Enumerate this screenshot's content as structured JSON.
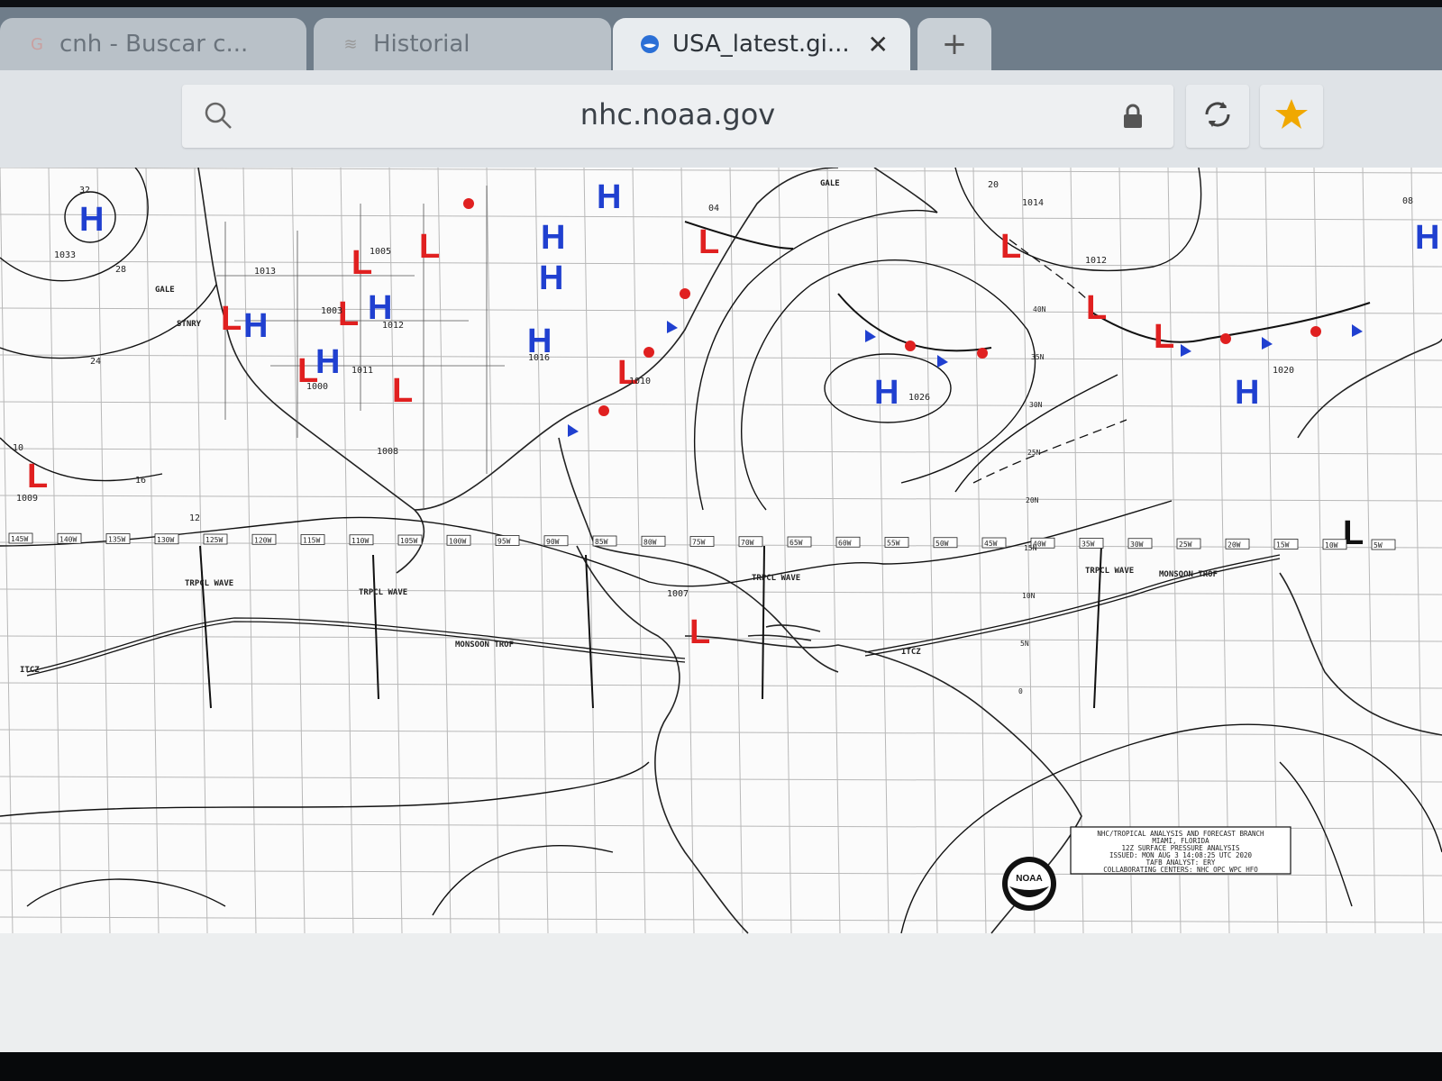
{
  "tabs": [
    {
      "label": "cnh - Buscar c...",
      "icon": "google-icon",
      "active": false
    },
    {
      "label": "Historial",
      "icon": "history-icon",
      "active": false
    },
    {
      "label": "USA_latest.gi...",
      "icon": "noaa-icon",
      "active": true
    }
  ],
  "toolbar": {
    "url": "nhc.noaa.gov"
  },
  "map": {
    "pressure_centers": [
      {
        "type": "H",
        "value": "1033"
      },
      {
        "type": "H",
        "value": "1026"
      },
      {
        "type": "H",
        "value": "1020"
      },
      {
        "type": "L",
        "value": "1009"
      },
      {
        "type": "L",
        "value": "1007"
      },
      {
        "type": "L",
        "value": "1000"
      },
      {
        "type": "L",
        "value": "1005"
      },
      {
        "type": "L",
        "value": "1014"
      },
      {
        "type": "L",
        "value": "1012"
      }
    ],
    "labels": {
      "itcz_w": "ITCZ",
      "itcz_e": "ITCZ",
      "monsoon_w": "MONSOON TROF",
      "monsoon_e": "MONSOON TROF",
      "trpcl1": "TRPCL WAVE",
      "trpcl2": "TRPCL WAVE",
      "trpcl3": "TRPCL WAVE",
      "trpcl4": "TRPCL WAVE",
      "gale1": "GALE",
      "gale2": "GALE",
      "stnry": "STNRY"
    },
    "longitudes": [
      "145W",
      "140W",
      "135W",
      "130W",
      "125W",
      "120W",
      "115W",
      "110W",
      "105W",
      "100W",
      "95W",
      "90W",
      "85W",
      "80W",
      "75W",
      "70W",
      "65W",
      "60W",
      "55W",
      "50W",
      "45W",
      "40W",
      "35W",
      "30W",
      "25W",
      "20W",
      "15W",
      "10W",
      "5W"
    ],
    "latitudes": [
      "40N",
      "35N",
      "30N",
      "25N",
      "20N",
      "15N",
      "10N",
      "5N",
      "0"
    ],
    "isobars": [
      "32",
      "28",
      "24",
      "20",
      "16",
      "12",
      "10",
      "08",
      "04",
      "1013",
      "1012",
      "1016",
      "1003",
      "1011",
      "1008",
      "1010"
    ],
    "legend_box": [
      "NHC/TROPICAL ANALYSIS AND FORECAST BRANCH",
      "MIAMI, FLORIDA",
      "12Z SURFACE PRESSURE ANALYSIS",
      "ISSUED: MON AUG 3 14:08:25 UTC 2020",
      "TAFB ANALYST: ERY",
      "COLLABORATING CENTERS: NHC OPC WPC HFO"
    ],
    "logo": "NOAA"
  }
}
